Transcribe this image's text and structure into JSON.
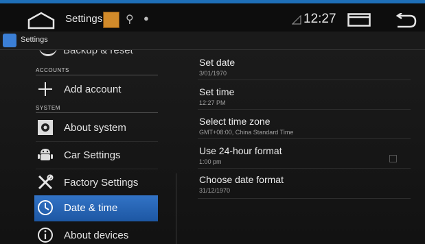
{
  "statusbar": {
    "title": "Settings",
    "clock": "12:27"
  },
  "appbar": {
    "name": "Settings"
  },
  "left": {
    "cut_item": "Backup & reset",
    "sections": {
      "accounts": "ACCOUNTS",
      "system": "SYSTEM"
    },
    "add_account": "Add account",
    "items": [
      {
        "label": "About system"
      },
      {
        "label": "Car Settings"
      },
      {
        "label": "Factory Settings"
      },
      {
        "label": "Date & time"
      },
      {
        "label": "About devices"
      }
    ]
  },
  "right": {
    "items": [
      {
        "title": "Set date",
        "summary": "3/01/1970"
      },
      {
        "title": "Set time",
        "summary": "12:27 PM"
      },
      {
        "title": "Select time zone",
        "summary": "GMT+08:00, China Standard Time"
      },
      {
        "title": "Use 24-hour format",
        "summary": "1:00 pm"
      },
      {
        "title": "Choose date format",
        "summary": "31/12/1970"
      }
    ]
  },
  "colors": {
    "accent": "#1e6fb8",
    "selected": "#2a68b8"
  }
}
